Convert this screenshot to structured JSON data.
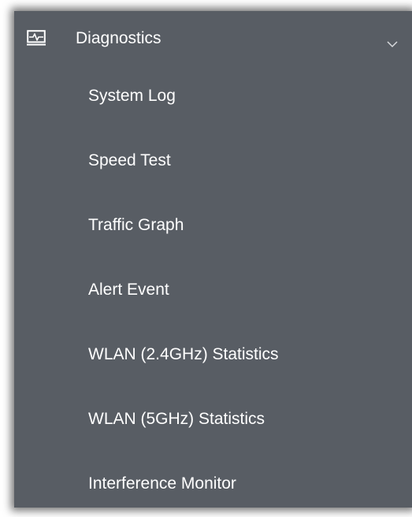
{
  "menu": {
    "header": {
      "label": "Diagnostics",
      "icon": "monitor-pulse-icon",
      "expand_icon": "chevron-down-icon",
      "expanded": true
    },
    "items": [
      {
        "label": "System Log"
      },
      {
        "label": "Speed Test"
      },
      {
        "label": "Traffic Graph"
      },
      {
        "label": "Alert Event"
      },
      {
        "label": "WLAN (2.4GHz) Statistics"
      },
      {
        "label": "WLAN (5GHz) Statistics"
      },
      {
        "label": "Interference Monitor"
      }
    ],
    "colors": {
      "background": "#585d64",
      "text": "#ffffff",
      "icon": "#ffffff"
    }
  }
}
